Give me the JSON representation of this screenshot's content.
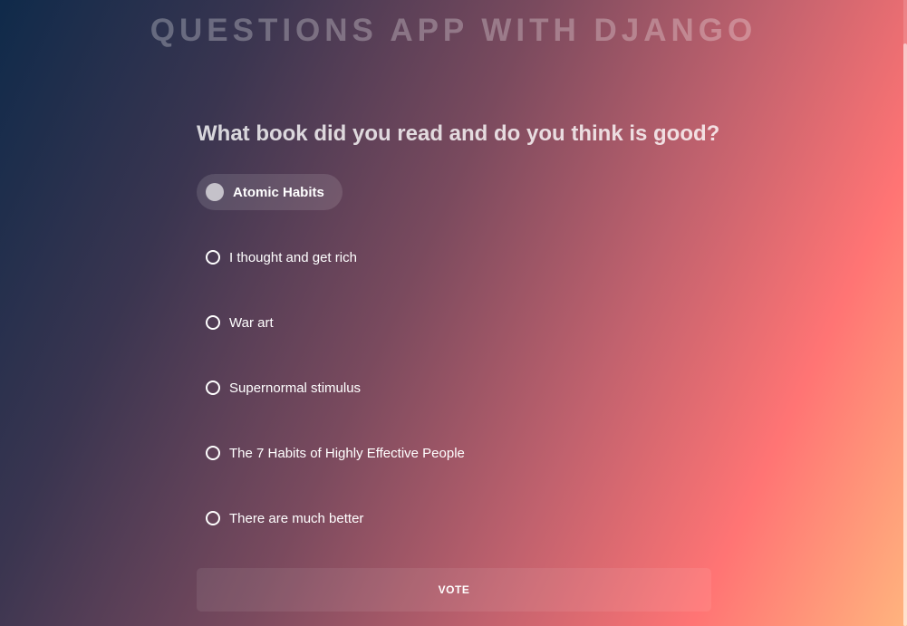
{
  "header": {
    "title": "QUESTIONS APP WITH DJANGO"
  },
  "poll": {
    "question": "What book did you read and do you think is good?",
    "selected_index": 0,
    "choices": [
      {
        "label": "Atomic Habits"
      },
      {
        "label": "I thought and get rich"
      },
      {
        "label": "War art"
      },
      {
        "label": "Supernormal stimulus"
      },
      {
        "label": "The 7 Habits of Highly Effective People"
      },
      {
        "label": "There are much better"
      }
    ],
    "vote_label": "VOTE"
  },
  "colors": {
    "gradient_start": "#0f2a4a",
    "gradient_mid": "#c2626e",
    "gradient_accent": "#ff7474",
    "gradient_end": "#ffb47e"
  },
  "icons": {
    "radio_selected": "radio-filled-icon",
    "radio_unselected": "radio-empty-icon"
  }
}
